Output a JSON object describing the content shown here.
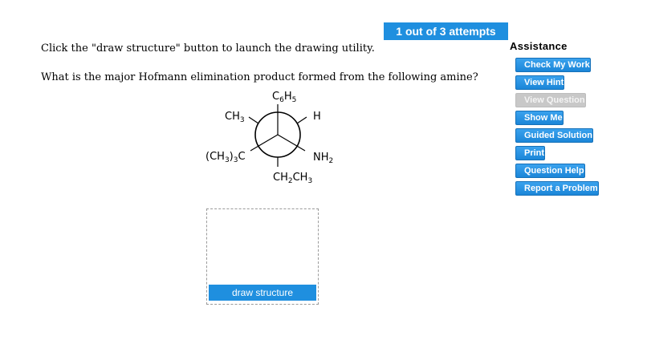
{
  "attempts": "1 out of 3 attempts",
  "instruction": "Click the \"draw structure\" button to launch the drawing utility.",
  "question": "What is the major Hofmann elimination product formed from the following amine?",
  "newman": {
    "top": {
      "base": "C",
      "sub": "6",
      "base2": "H",
      "sub2": "5"
    },
    "upper_left": {
      "base": "CH",
      "sub": "3"
    },
    "upper_right": {
      "base": "H"
    },
    "lower_left": {
      "pre": "(CH",
      "sub": "3",
      "post": ")",
      "sub2": "3",
      "post2": "C"
    },
    "lower_right": {
      "base": "NH",
      "sub": "2"
    },
    "bottom": {
      "base": "CH",
      "sub": "2",
      "base2": "CH",
      "sub2": "3"
    }
  },
  "draw_button": "draw structure",
  "assistance": {
    "title": "Assistance",
    "items": [
      {
        "label": "Check My Work",
        "enabled": true
      },
      {
        "label": "View Hint",
        "enabled": true
      },
      {
        "label": "View Question",
        "enabled": false
      },
      {
        "label": "Show Me",
        "enabled": true
      },
      {
        "label": "Guided Solution",
        "enabled": true
      },
      {
        "label": "Print",
        "enabled": true
      },
      {
        "label": "Question Help",
        "enabled": true
      },
      {
        "label": "Report a Problem",
        "enabled": true
      }
    ]
  },
  "colors": {
    "accent": "#1f8fdf",
    "disabled": "#c8c8c8"
  }
}
